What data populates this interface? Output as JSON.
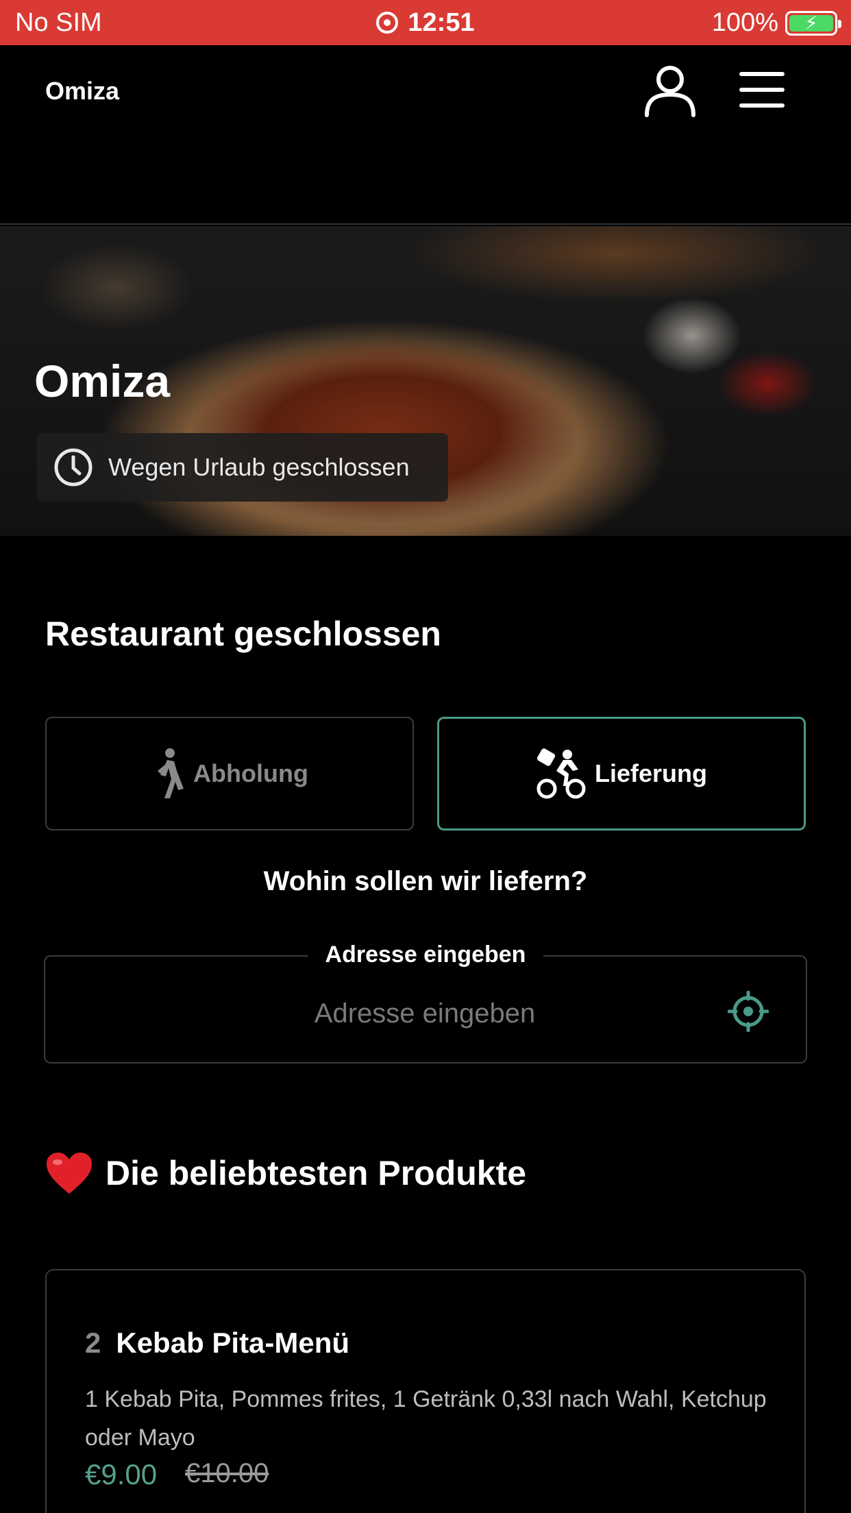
{
  "status_bar": {
    "carrier": "No SIM",
    "time": "12:51",
    "battery": "100%"
  },
  "header": {
    "brand": "Omiza",
    "icons": [
      "user-icon",
      "menu-icon"
    ]
  },
  "hero": {
    "title": "Omiza",
    "status": "Wegen Urlaub geschlossen",
    "status_icon": "clock-icon"
  },
  "main": {
    "section_title": "Restaurant geschlossen",
    "modes": [
      {
        "label": "Abholung",
        "icon": "walking-icon",
        "selected": false
      },
      {
        "label": "Lieferung",
        "icon": "bicycle-icon",
        "selected": true
      }
    ],
    "question": "Wohin sollen wir liefern?",
    "address": {
      "label": "Adresse eingeben",
      "placeholder": "Adresse eingeben",
      "value": "",
      "icon": "locate-icon"
    },
    "popular_title": "Die beliebtesten Produkte",
    "popular_icon": "heart-icon",
    "products": [
      {
        "qty": "2",
        "name": "Kebab Pita-Menü",
        "description": "1 Kebab Pita, Pommes frites, 1 Getränk 0,33l nach Wahl, Ketchup oder Mayo",
        "price": "€9.00",
        "old_price": "€10.00"
      }
    ]
  },
  "colors": {
    "status_bar": "#d93a34",
    "accent": "#4a9a88",
    "price": "#56a08d",
    "background": "#000000"
  }
}
